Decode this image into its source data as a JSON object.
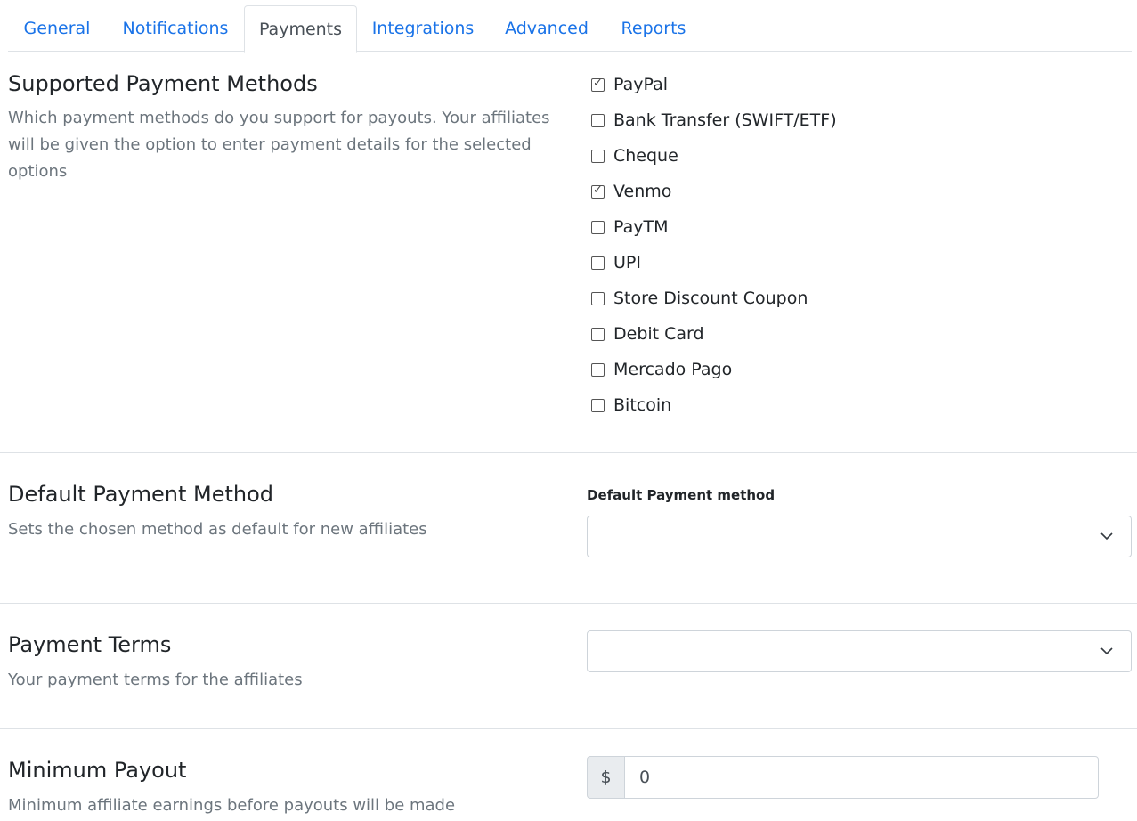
{
  "tabs": [
    {
      "label": "General",
      "active": false
    },
    {
      "label": "Notifications",
      "active": false
    },
    {
      "label": "Payments",
      "active": true
    },
    {
      "label": "Integrations",
      "active": false
    },
    {
      "label": "Advanced",
      "active": false
    },
    {
      "label": "Reports",
      "active": false
    }
  ],
  "supported_methods": {
    "title": "Supported Payment Methods",
    "description": "Which payment methods do you support for payouts. Your affiliates will be given the option to enter payment details for the selected options",
    "options": [
      {
        "label": "PayPal",
        "checked": true
      },
      {
        "label": "Bank Transfer (SWIFT/ETF)",
        "checked": false
      },
      {
        "label": "Cheque",
        "checked": false
      },
      {
        "label": "Venmo",
        "checked": true
      },
      {
        "label": "PayTM",
        "checked": false
      },
      {
        "label": "UPI",
        "checked": false
      },
      {
        "label": "Store Discount Coupon",
        "checked": false
      },
      {
        "label": "Debit Card",
        "checked": false
      },
      {
        "label": "Mercado Pago",
        "checked": false
      },
      {
        "label": "Bitcoin",
        "checked": false
      }
    ]
  },
  "default_method": {
    "title": "Default Payment Method",
    "description": "Sets the chosen method as default for new affiliates",
    "field_label": "Default Payment method",
    "selected_value": ""
  },
  "payment_terms": {
    "title": "Payment Terms",
    "description": "Your payment terms for the affiliates",
    "selected_value": ""
  },
  "minimum_payout": {
    "title": "Minimum Payout",
    "description": "Minimum affiliate earnings before payouts will be made",
    "currency_symbol": "$",
    "value": "0"
  },
  "icons": {
    "select_chevron": "chevron-down-icon",
    "checkbox_check": "check-icon"
  },
  "colors": {
    "link": "#1a73e8",
    "muted_text": "#6c757d",
    "border": "#dee2e6"
  }
}
